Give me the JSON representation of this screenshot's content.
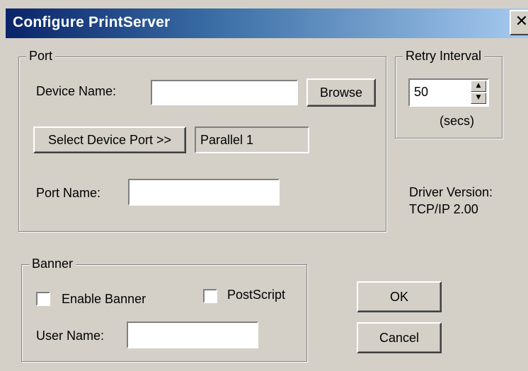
{
  "window": {
    "title": "Configure PrintServer",
    "close_symbol": "✕"
  },
  "port_group": {
    "legend": "Port",
    "device_name_label": "Device Name:",
    "device_name_value": "",
    "browse_label": "Browse",
    "select_port_label": "Select Device Port >>",
    "selected_port_value": "Parallel 1",
    "port_name_label": "Port Name:",
    "port_name_value": ""
  },
  "retry_group": {
    "legend": "Retry Interval",
    "value": "50",
    "unit": "(secs)",
    "spin_up": "▲",
    "spin_down": "▼"
  },
  "driver": {
    "version_label": "Driver Version:",
    "version_value": "TCP/IP  2.00"
  },
  "banner_group": {
    "legend": "Banner",
    "enable_banner_label": "Enable Banner",
    "enable_banner_checked": false,
    "postscript_label": "PostScript",
    "postscript_checked": false,
    "user_name_label": "User Name:",
    "user_name_value": ""
  },
  "buttons": {
    "ok_label": "OK",
    "cancel_label": "Cancel"
  },
  "colors": {
    "dialog_bg": "#d4d0c8",
    "title_gradient_start": "#0a246a",
    "title_gradient_end": "#a6caf0"
  }
}
